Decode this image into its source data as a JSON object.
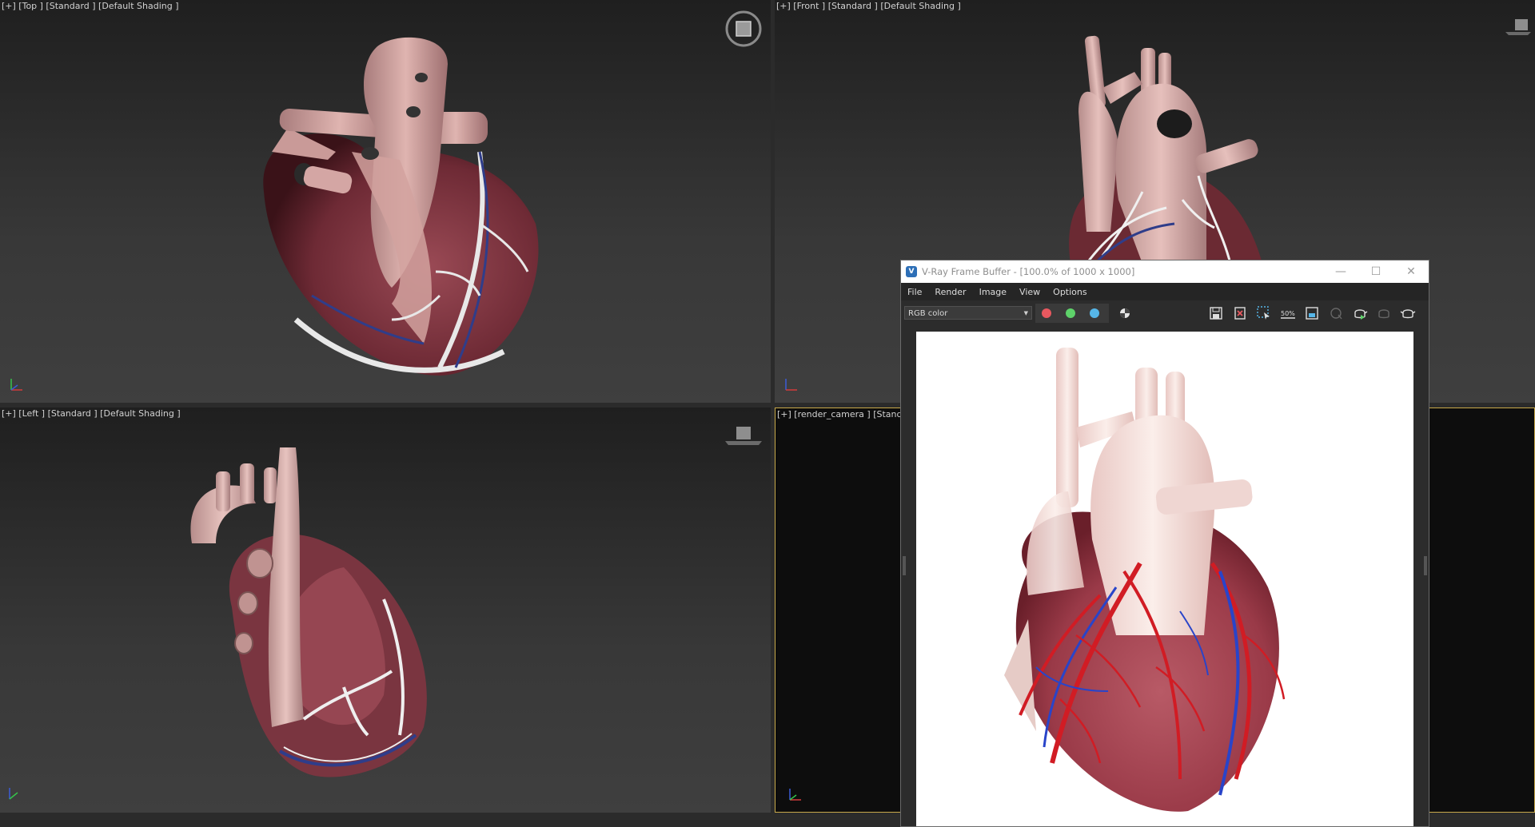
{
  "viewports": {
    "top": {
      "label": "[+] [Top ] [Standard ] [Default Shading ]"
    },
    "front": {
      "label": "[+] [Front ] [Standard ] [Default Shading ]"
    },
    "left": {
      "label": "[+] [Left ] [Standard ] [Default Shading ]"
    },
    "camera": {
      "label": "[+] [render_camera ] [Standard"
    }
  },
  "vfb": {
    "title": "V-Ray Frame Buffer - [100.0% of 1000 x 1000]",
    "logo": "V",
    "menu": [
      "File",
      "Render",
      "Image",
      "View",
      "Options"
    ],
    "channel": "RGB color",
    "icons": [
      "save-icon",
      "clear-icon",
      "region-select-icon",
      "zoom-50-icon",
      "frame-icon",
      "last-region-icon",
      "render-teapot-icon",
      "stop-teapot-icon",
      "teapot-icon"
    ],
    "zoom_icon_text": "50%",
    "colors": {
      "red": "#e8585f",
      "green": "#5ed26a",
      "blue": "#56b6e8"
    }
  }
}
